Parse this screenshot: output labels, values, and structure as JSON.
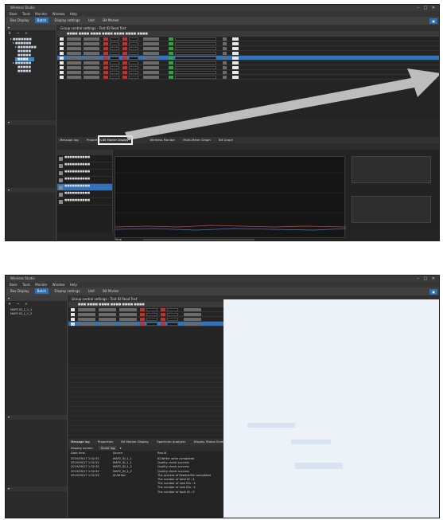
{
  "shot1": {
    "title": "Wireless Studio",
    "menus": [
      "Base",
      "Tools",
      "Monitor",
      "Window",
      "Help"
    ],
    "toolbar_tabs": [
      "Box Display",
      "Batch",
      "Display settings",
      "Unit",
      "Bit Marker"
    ],
    "group_title": "Group control settings - Test ID Read Test",
    "tabs": [
      "Message log",
      "Properties",
      "Bit Marker Display",
      "",
      "Wireless Monitor",
      "Multi-Meter Graph",
      "Bit Graph"
    ],
    "highlight_tab": "Bit Marker Display",
    "chart_bottom_label": "Time"
  },
  "shot2": {
    "title": "Wireless Studio",
    "menus": [
      "Base",
      "Tools",
      "Monitor",
      "Window",
      "Help"
    ],
    "toolbar_tabs": [
      "Box Display",
      "Batch",
      "Display settings",
      "Unit",
      "Bit Marker"
    ],
    "group_title": "Group control settings - Test ID Read Test",
    "tree": [
      "MAP2 ID_1_1_1",
      "MAP2 ID_1_1_2"
    ],
    "tabs": [
      "Message log",
      "Properties",
      "Bit Marker Display",
      "Spectrum Analyzer",
      "Display Status Screen"
    ],
    "display_label": "Display screen",
    "display_value": "Scroll log",
    "log_headers": [
      "Date time",
      "Source",
      "Result"
    ],
    "log_rows": [
      [
        "2019/09/17 1:32:32",
        "MAP2_ID_1_1",
        "ID-Writer write completed"
      ],
      [
        "2019/09/17 1:32:32",
        "MAP2_ID_1_1",
        "Quality check success"
      ],
      [
        "2019/09/17 1:32:32",
        "MAP2_ID_1_2",
        "Quality check success"
      ],
      [
        "2019/09/17 1:32:32",
        "MAP2_ID_1_2",
        "Quality check success"
      ],
      [
        "2019/09/17 1:32:33",
        "ID-Writer",
        "The process of Read/write completed"
      ],
      [
        "",
        "",
        "The number of total ID : 4"
      ],
      [
        "",
        "",
        "The number of new IDs : 4"
      ],
      [
        "",
        "",
        "The number of new IDs : 4"
      ],
      [
        "",
        "",
        "The number of fault ID : 0"
      ]
    ]
  }
}
